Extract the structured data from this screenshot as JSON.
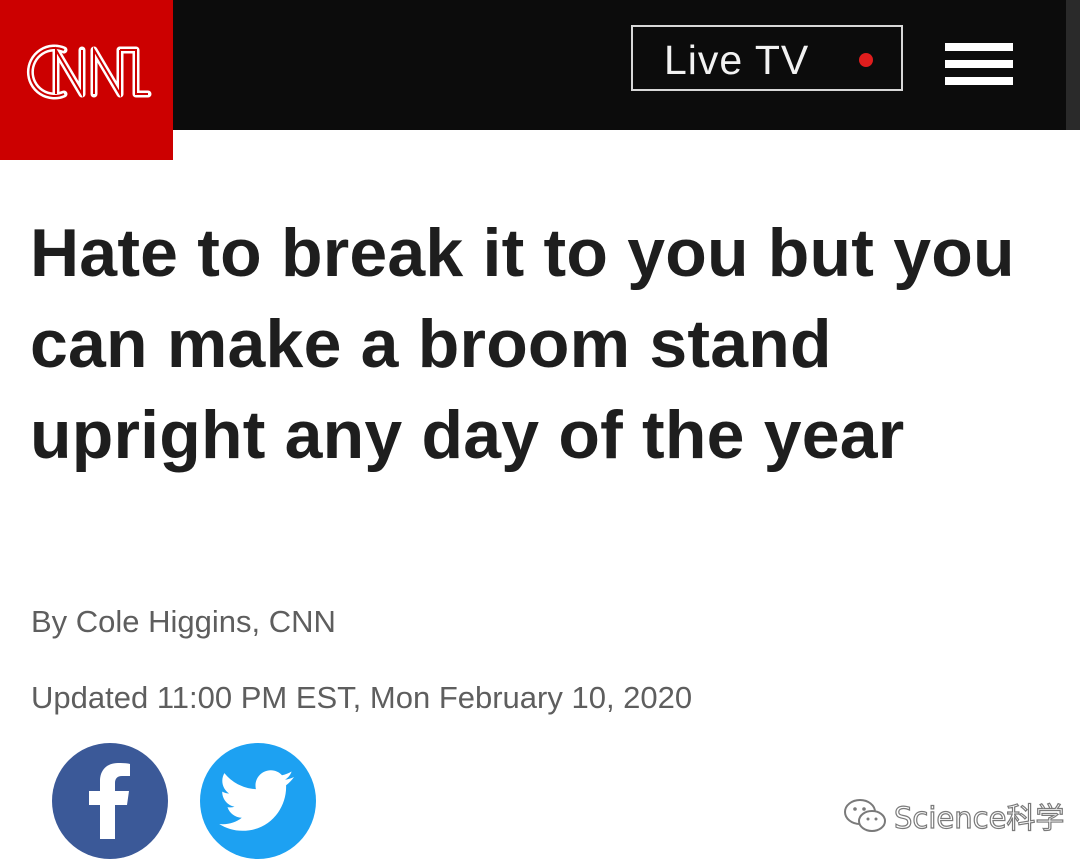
{
  "brand": {
    "logo_text": "CNN",
    "accent_color": "#cc0000",
    "header_color": "#0c0c0c"
  },
  "header": {
    "live_label": "Live TV",
    "live_dot_color": "#e01d1d",
    "menu_icon": "hamburger-menu-icon"
  },
  "article": {
    "headline": "Hate to break it to you but you can make a broom stand upright any day of the year",
    "byline": "By Cole Higgins, CNN",
    "updated": "Updated 11:00 PM EST, Mon February 10, 2020"
  },
  "share": {
    "facebook_icon": "facebook-icon",
    "facebook_color": "#3b5998",
    "twitter_icon": "twitter-icon",
    "twitter_color": "#1da1f2"
  },
  "watermark": {
    "icon": "wechat-icon",
    "text": "Science科学"
  }
}
